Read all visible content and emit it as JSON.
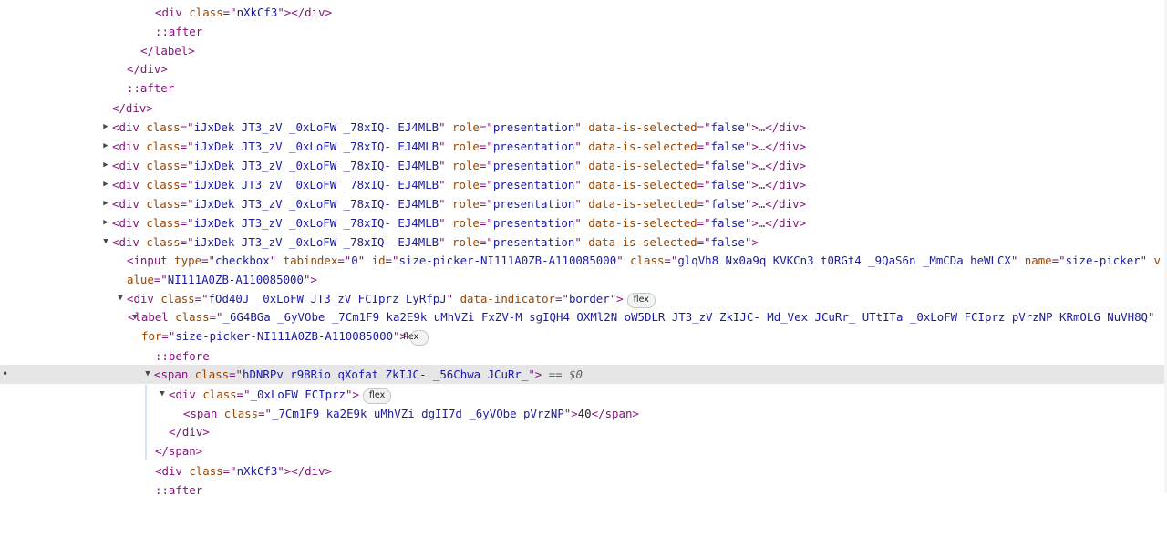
{
  "tokens": {
    "div": "div",
    "label": "label",
    "span": "span",
    "input": "input",
    "class": "class",
    "role": "role",
    "data_is_selected": "data-is-selected",
    "data_indicator": "data-indicator",
    "type": "type",
    "tabindex": "tabindex",
    "id": "id",
    "name": "name",
    "value": "value",
    "for": "for",
    "presentation": "presentation",
    "false": "false",
    "border": "border",
    "checkbox": "checkbox",
    "zero": "0",
    "after": "::after",
    "before": "::before",
    "flex": "flex",
    "ellipsis": "…",
    "selected_marker": "== $0",
    "text_40": "40",
    "collapsed_arrow": "▶",
    "expanded_arrow": "▼"
  },
  "classes": {
    "nxkcf3": "nXkCf3",
    "row": "iJxDek JT3_zV _0xLoFW _78xIQ- EJ4MLB",
    "input": "glqVh8 Nx0a9q KVKCn3 t0RGt4 _9QaS6n _MmCDa heWLCX",
    "indicator": "fOd40J _0xLoFW JT3_zV FCIprz LyRfpJ",
    "label": "_6G4BGa _6yVObe _7Cm1F9 ka2E9k uMhVZi FxZV-M sgIQH4 OXMl2N oW5DLR JT3_zV ZkIJC- Md_Vex JCuRr_ UTtITa _0xLoFW FCIprz pVrzNP KRmOLG NuVH8Q",
    "span_selected": "hDNRPv r9BRio qXofat ZkIJC- _56Chwa JCuRr_",
    "inner_div": "_0xLoFW FCIprz",
    "inner_span": "_7Cm1F9 ka2E9k uMhVZi dgII7d _6yVObe pVrzNP"
  },
  "ids": {
    "size_picker": "size-picker-NI111A0ZB-A110085000",
    "input_name": "size-picker",
    "input_value": "NI111A0ZB-A110085000"
  }
}
